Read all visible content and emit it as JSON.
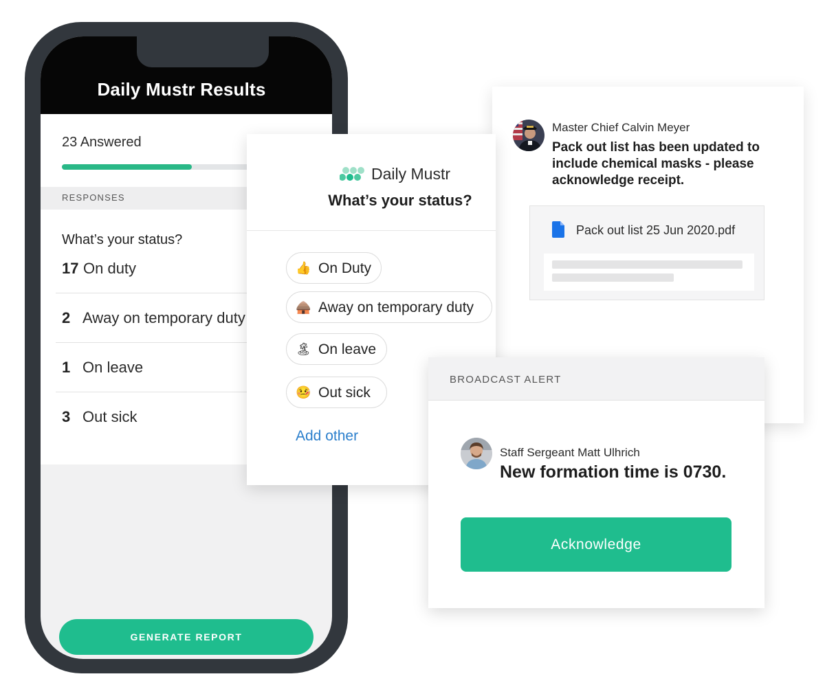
{
  "phone": {
    "title": "Daily Mustr Results",
    "answered": "23 Answered",
    "progress": 0.63,
    "responses_label": "RESPONSES",
    "question": "What’s your status?",
    "results": [
      {
        "count": "17",
        "label": "On duty"
      },
      {
        "count": "2",
        "label": "Away on temporary duty"
      },
      {
        "count": "1",
        "label": "On leave"
      },
      {
        "count": "3",
        "label": "Out sick"
      }
    ],
    "generate_label": "GENERATE REPORT"
  },
  "survey": {
    "brand": "Daily Mustr",
    "question": "What’s your status?",
    "options": [
      {
        "emoji": "👍",
        "label": "On Duty"
      },
      {
        "emoji": "🛖",
        "label": "Away on temporary duty"
      },
      {
        "emoji": "🏝",
        "label": "On leave"
      },
      {
        "emoji": "🤒",
        "label": "Out sick"
      }
    ],
    "add_other": "Add other"
  },
  "message": {
    "sender": "Master Chief Calvin Meyer",
    "body": "Pack out list has been updated to include chemical masks - please acknowledge receipt.",
    "attachment": "Pack out list 25 Jun 2020.pdf"
  },
  "broadcast": {
    "header": "BROADCAST ALERT",
    "sender": "Staff Sergeant Matt Ulhrich",
    "message": "New formation time is 0730.",
    "ack_label": "Acknowledge"
  },
  "colors": {
    "accent": "#1fbd8e",
    "link": "#2b7fcc",
    "phone_frame": "#32373d"
  }
}
